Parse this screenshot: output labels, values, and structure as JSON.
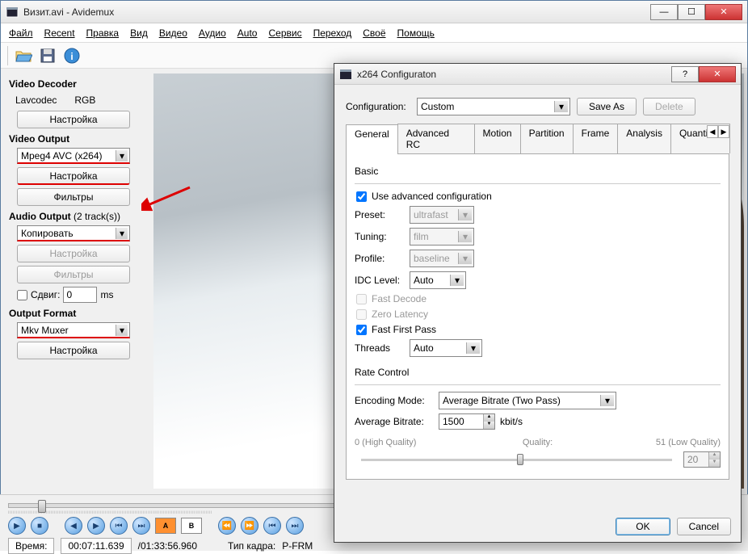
{
  "window": {
    "title": "Визит.avi - Avidemux",
    "menu": [
      "Файл",
      "Recent",
      "Правка",
      "Вид",
      "Видео",
      "Аудио",
      "Auto",
      "Сервис",
      "Переход",
      "Своё",
      "Помощь"
    ]
  },
  "sidebar": {
    "video_decoder_title": "Video Decoder",
    "lavcodec": "Lavcodec",
    "rgb": "RGB",
    "configure_btn": "Настройка",
    "video_output_title": "Video Output",
    "video_codec": "Mpeg4 AVC (x264)",
    "filters_btn": "Фильтры",
    "audio_output_title": "Audio Output",
    "audio_tracks": "(2 track(s))",
    "audio_mode": "Копировать",
    "shift_label": "Сдвиг:",
    "shift_value": "0",
    "shift_unit": "ms",
    "output_format_title": "Output Format",
    "muxer": "Mkv Muxer"
  },
  "status": {
    "time_label": "Время:",
    "current_time": "00:07:11.639",
    "total_time": "/01:33:56.960",
    "frame_type_label": "Тип кадра:",
    "frame_type": "P-FRM"
  },
  "dialog": {
    "title": "x264 Configuraton",
    "config_label": "Configuration:",
    "config_value": "Custom",
    "save_as": "Save As",
    "delete": "Delete",
    "tabs": [
      "General",
      "Advanced RC",
      "Motion",
      "Partition",
      "Frame",
      "Analysis",
      "Quantiser"
    ],
    "basic_label": "Basic",
    "use_advanced": "Use advanced configuration",
    "preset_label": "Preset:",
    "preset_value": "ultrafast",
    "tuning_label": "Tuning:",
    "tuning_value": "film",
    "profile_label": "Profile:",
    "profile_value": "baseline",
    "idc_label": "IDC Level:",
    "idc_value": "Auto",
    "fast_decode": "Fast Decode",
    "zero_latency": "Zero Latency",
    "fast_first_pass": "Fast First Pass",
    "threads_label": "Threads",
    "threads_value": "Auto",
    "rate_control_label": "Rate Control",
    "encoding_mode_label": "Encoding Mode:",
    "encoding_mode_value": "Average Bitrate (Two Pass)",
    "avg_bitrate_label": "Average Bitrate:",
    "avg_bitrate_value": "1500",
    "kbits": "kbit/s",
    "quality_left": "0 (High Quality)",
    "quality_center": "Quality:",
    "quality_right": "51 (Low Quality)",
    "quality_value": "20",
    "ok": "OK",
    "cancel": "Cancel"
  }
}
